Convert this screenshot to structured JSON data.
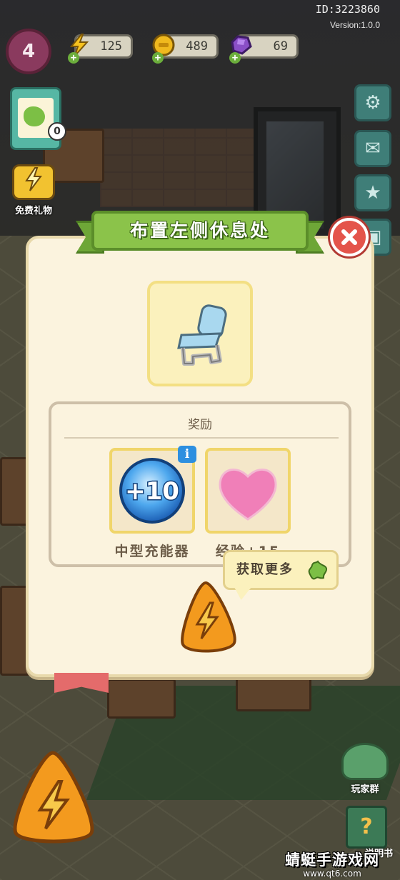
{
  "hud": {
    "level": "4",
    "energy": "125",
    "coins": "489",
    "gems": "69",
    "plus_symbol": "+",
    "id_text": "ID:3223860",
    "version_text": "Version:1.0.0",
    "quest_count": "0",
    "gift_label": "免费礼物",
    "group_label": "玩家群",
    "help_label": "说明书"
  },
  "dialog": {
    "title": "布置左侧休息处",
    "reward_heading": "奖励",
    "rewards": [
      {
        "label": "中型充能器",
        "amount": "+10",
        "icon": "charger-orb-icon"
      },
      {
        "label": "经验+15",
        "icon": "heart-icon"
      }
    ],
    "info_symbol": "i",
    "get_more_label": "获取更多",
    "item_icon": "chair-icon"
  },
  "watermark": {
    "title": "蜻蜓手游戏网",
    "url": "www.qt6.com"
  },
  "colors": {
    "banner_green": "#8bc34a",
    "close_red": "#e4544b",
    "panel_cream": "#fbf3de",
    "action_orange": "#f39a1e"
  }
}
